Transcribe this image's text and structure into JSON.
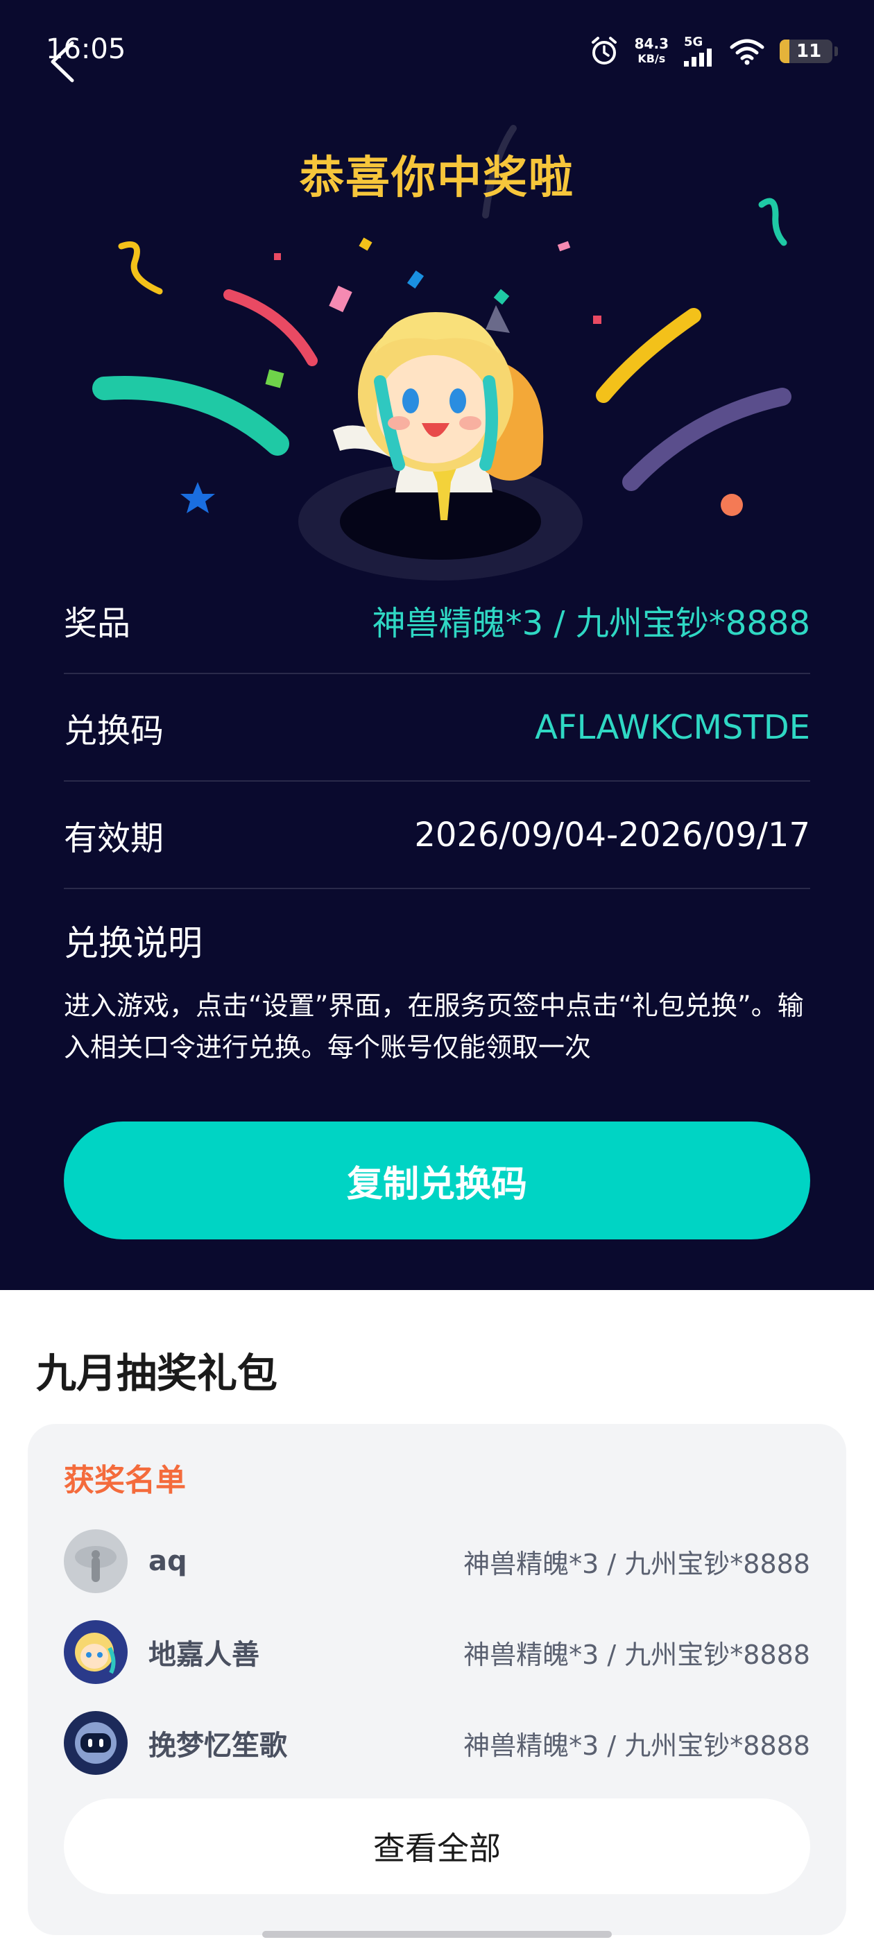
{
  "status_bar": {
    "time": "16:05",
    "speed_value": "84.3",
    "speed_unit": "KB/s",
    "network": "5G",
    "battery": "11"
  },
  "result": {
    "title": "恭喜你中奖啦",
    "rows": [
      {
        "label": "奖品",
        "value": "神兽精魄*3 / 九州宝钞*8888"
      },
      {
        "label": "兑换码",
        "value": "AFLAWKCMSTDE"
      },
      {
        "label": "有效期",
        "value": "2026/09/04-2026/09/17"
      }
    ],
    "redeem_title": "兑换说明",
    "redeem_desc": "进入游戏，点击“设置”界面，在服务页签中点击“礼包兑换”。输入相关口令进行兑换。每个账号仅能领取一次",
    "copy_button": "复制兑换码"
  },
  "lottery": {
    "title": "九月抽奖礼包",
    "winners_title": "获奖名单",
    "winners": [
      {
        "name": "aq",
        "prize": "神兽精魄*3 / 九州宝钞*8888"
      },
      {
        "name": "地嘉人善",
        "prize": "神兽精魄*3 / 九州宝钞*8888"
      },
      {
        "name": "挽梦忆笙歌",
        "prize": "神兽精魄*3 / 九州宝钞*8888"
      }
    ],
    "view_all": "查看全部"
  },
  "colors": {
    "bg_dark": "#0a0a2e",
    "accent_teal": "#2fd8c4",
    "button_teal": "#00d4c4",
    "title_gold": "#f7c63b",
    "winners_orange": "#f46b3c"
  }
}
